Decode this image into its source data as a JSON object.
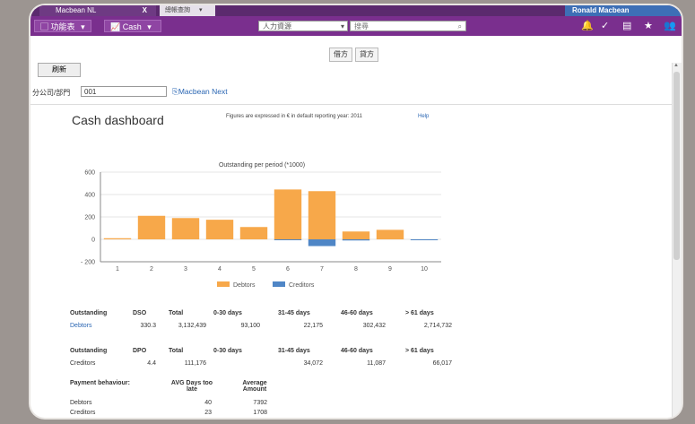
{
  "window": {
    "tab_active": "Macbean NL",
    "tab_close": "X",
    "tab_second": "總帳查詢",
    "user": "Ronald Macbean"
  },
  "toolbar": {
    "function_menu": "功能表",
    "cash_menu": "Cash",
    "module_select": "人力資源",
    "search_placeholder": "搜尋",
    "icons": [
      "bell-icon",
      "check-icon",
      "document-icon",
      "star-icon",
      "users-icon"
    ]
  },
  "actions": {
    "debit": "借方",
    "credit": "貸方",
    "refresh": "刷新"
  },
  "filter": {
    "label": "分公司/部門",
    "value": "001",
    "link": "Macbean Next"
  },
  "dashboard": {
    "title": "Cash dashboard",
    "note": "Figures are expressed in € in default reporting year: 2011",
    "help": "Help"
  },
  "chart_data": {
    "type": "bar",
    "title": "Outstanding per period (*1000)",
    "categories": [
      "1",
      "2",
      "3",
      "4",
      "5",
      "6",
      "7",
      "8",
      "9",
      "10"
    ],
    "series": [
      {
        "name": "Debtors",
        "color": "#f7a84a",
        "values": [
          10,
          210,
          190,
          175,
          110,
          445,
          430,
          70,
          85,
          0
        ]
      },
      {
        "name": "Creditors",
        "color": "#4f86c6",
        "values": [
          0,
          0,
          0,
          0,
          0,
          -5,
          -60,
          -10,
          0,
          -5
        ]
      }
    ],
    "ylim": [
      -200,
      600
    ],
    "yticks": [
      "600",
      "400",
      "200",
      "0",
      "- 200"
    ],
    "ytick_values": [
      600,
      400,
      200,
      0,
      -200
    ],
    "legend": "bottom",
    "grid": true
  },
  "tables": {
    "debtors": {
      "headers": [
        "Outstanding",
        "DSO",
        "Total",
        "0-30 days",
        "31-45 days",
        "46-60 days",
        "> 61 days"
      ],
      "row": [
        "Debtors",
        "330.3",
        "3,132,439",
        "93,100",
        "22,175",
        "302,432",
        "2,714,732"
      ]
    },
    "creditors": {
      "headers": [
        "Outstanding",
        "DPO",
        "Total",
        "0-30 days",
        "31-45 days",
        "46-60 days",
        "> 61 days"
      ],
      "row": [
        "Creditors",
        "4.4",
        "111,176",
        "",
        "34,072",
        "11,087",
        "66,017"
      ]
    },
    "payment": {
      "headers": [
        "Payment behaviour:",
        "AVG Days too late",
        "Average Amount"
      ],
      "rows": [
        [
          "Debtors",
          "40",
          "7392"
        ],
        [
          "Creditors",
          "23",
          "1708"
        ]
      ]
    }
  }
}
